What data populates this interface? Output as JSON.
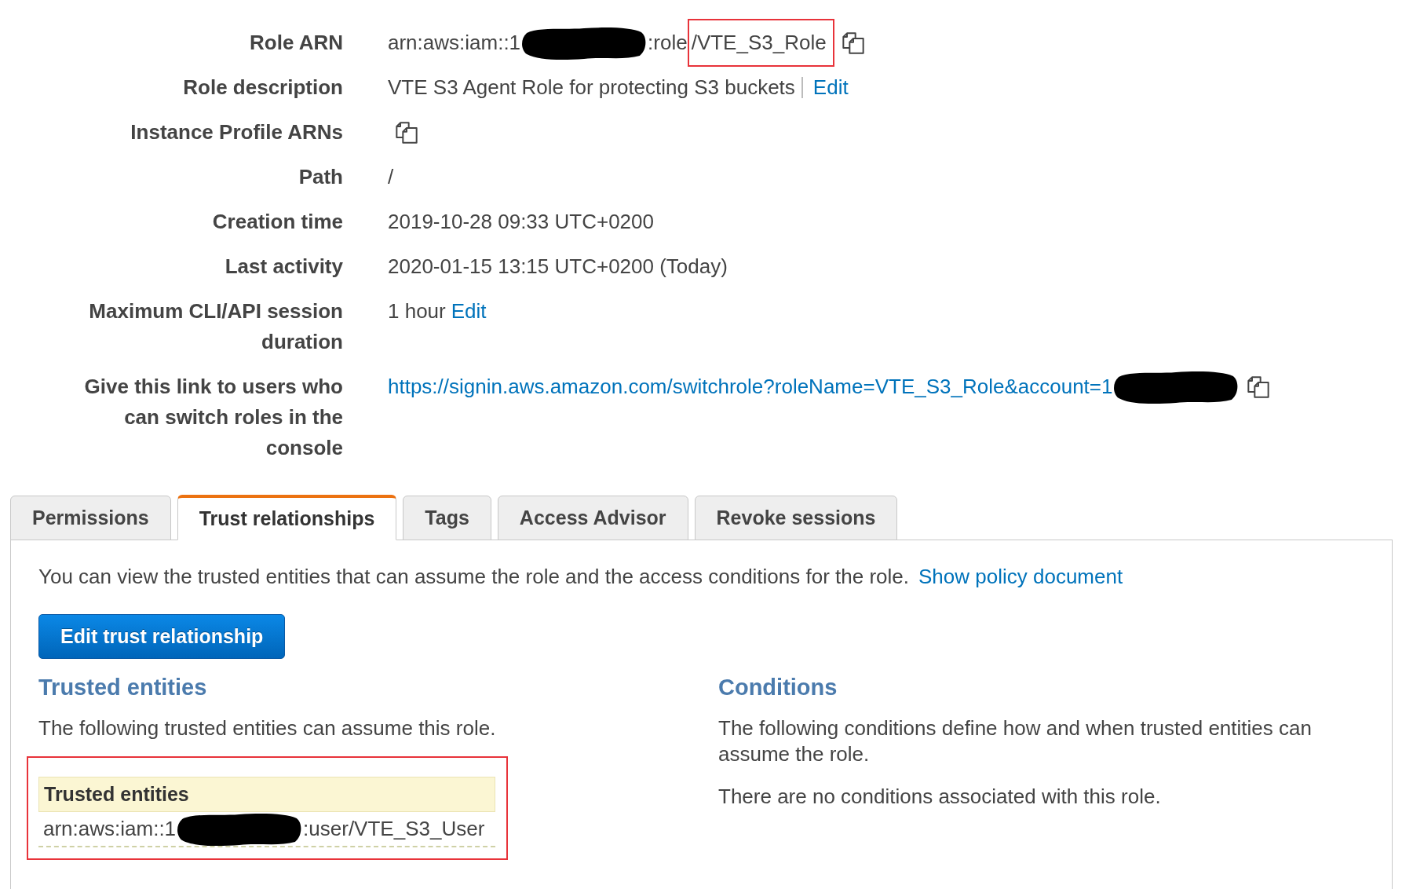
{
  "details": [
    {
      "label": "Role ARN",
      "value": [
        {
          "kind": "text",
          "text": "arn:aws:iam::1"
        },
        {
          "kind": "redaction"
        },
        {
          "kind": "text",
          "text": ":role"
        },
        {
          "kind": "highlight",
          "text": "/VTE_S3_Role"
        },
        {
          "kind": "copy"
        }
      ]
    },
    {
      "label": "Role description",
      "value": [
        {
          "kind": "text",
          "text": "VTE S3 Agent Role for protecting S3 buckets"
        },
        {
          "kind": "separator"
        },
        {
          "kind": "link",
          "text": "Edit"
        }
      ]
    },
    {
      "label": "Instance Profile ARNs",
      "value": [
        {
          "kind": "copy"
        }
      ]
    },
    {
      "label": "Path",
      "value": [
        {
          "kind": "text",
          "text": "/"
        }
      ]
    },
    {
      "label": "Creation time",
      "value": [
        {
          "kind": "text",
          "text": "2019-10-28 09:33 UTC+0200"
        }
      ]
    },
    {
      "label": "Last activity",
      "value": [
        {
          "kind": "text",
          "text": "2020-01-15 13:15 UTC+0200 (Today)"
        }
      ]
    },
    {
      "label": "Maximum CLI/API session duration",
      "value": [
        {
          "kind": "text",
          "text": "1 hour"
        },
        {
          "kind": "link",
          "text": "Edit"
        }
      ]
    },
    {
      "label": "Give this link to users who can switch roles in the console",
      "value": [
        {
          "kind": "link",
          "text": "https://signin.aws.amazon.com/switchrole?roleName=VTE_S3_Role&account=1"
        },
        {
          "kind": "redaction"
        },
        {
          "kind": "copy"
        }
      ]
    }
  ],
  "tabs": [
    {
      "label": "Permissions",
      "selected": false
    },
    {
      "label": "Trust relationships",
      "selected": true
    },
    {
      "label": "Tags",
      "selected": false
    },
    {
      "label": "Access Advisor",
      "selected": false
    },
    {
      "label": "Revoke sessions",
      "selected": false
    }
  ],
  "trust_panel": {
    "intro": "You can view the trusted entities that can assume the role and the access conditions for the role.",
    "policy_link": "Show policy document",
    "edit_button": "Edit trust relationship",
    "trusted_entities": {
      "heading": "Trusted entities",
      "description": "The following trusted entities can assume this role.",
      "highlighted": true,
      "table": {
        "columns": [
          "Trusted entities"
        ],
        "rows": [
          [
            {
              "kind": "text",
              "text": "arn:aws:iam::1"
            },
            {
              "kind": "redaction"
            },
            {
              "kind": "text",
              "text": ":user/VTE_S3_User"
            }
          ]
        ]
      }
    },
    "conditions": {
      "heading": "Conditions",
      "description": "The following conditions define how and when trusted entities can assume the role.",
      "note": "There are no conditions associated with this role."
    }
  }
}
